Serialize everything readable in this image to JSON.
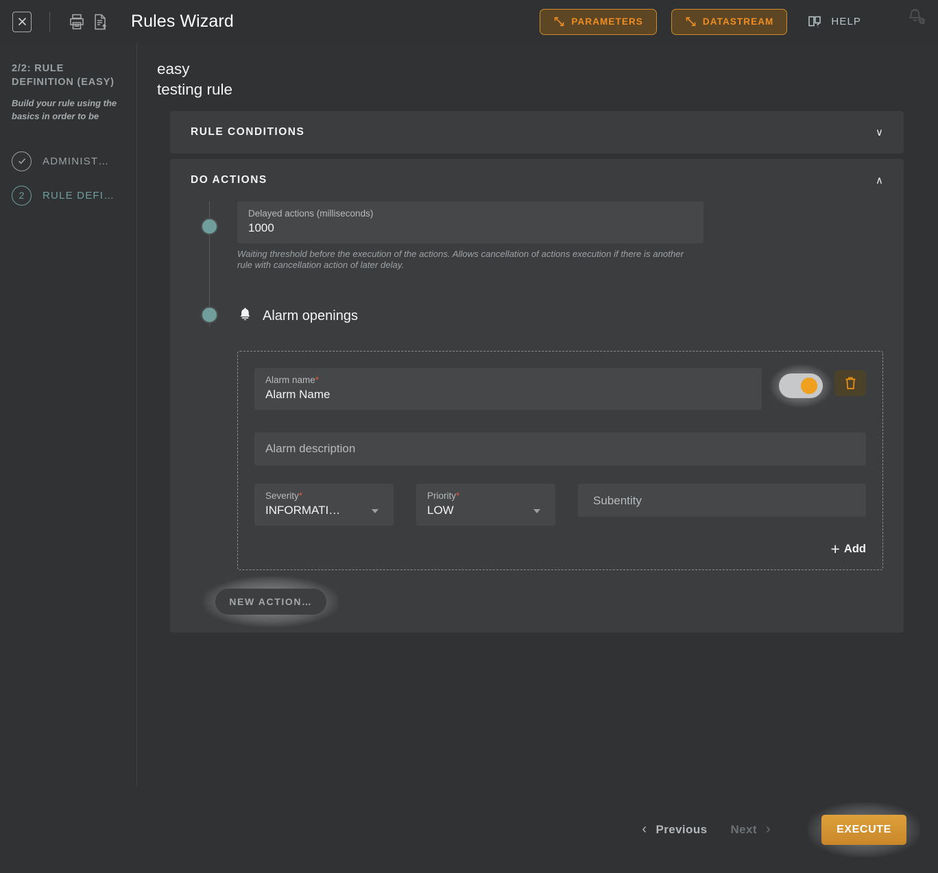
{
  "topbar": {
    "close_label": "☒",
    "close_icon": "close-boxed-icon",
    "print_icon": "print-icon",
    "export_icon": "document-upload-icon",
    "title": "Rules Wizard",
    "parameters_label": "PARAMETERS",
    "datastream_label": "DATASTREAM",
    "help_label": "HELP",
    "notification_settings_icon": "bell-gear-icon",
    "accent_orange": "#ef8e26"
  },
  "sidebar": {
    "step_heading": "2/2: RULE DEFINITION (EASY)",
    "step_description": "Build your rule using the basics in order to be",
    "steps": [
      {
        "icon": "check-circle-icon",
        "marker": "✓",
        "label": "ADMINIST…",
        "active": false
      },
      {
        "icon": "step-number-icon",
        "marker": "2",
        "label": "RULE DEFI…",
        "active": true
      }
    ],
    "active_color": "#6f9e9d"
  },
  "main": {
    "rule_title": "easy testing rule",
    "panels": [
      {
        "title": "RULE CONDITIONS",
        "expanded": false,
        "chevron": "∨"
      },
      {
        "title": "DO ACTIONS",
        "expanded": true,
        "chevron": "∧"
      }
    ],
    "delayed_actions": {
      "label": "Delayed actions (milliseconds)",
      "value": "1000",
      "helper": "Waiting threshold before the execution of the actions. Allows cancellation of actions execution if there is another rule with cancellation action of later delay."
    },
    "alarm_action": {
      "icon": "bell-icon",
      "heading": "Alarm openings",
      "alarm_name": {
        "label": "Alarm name",
        "required_mark": "*",
        "value": "Alarm Name"
      },
      "toggle": {
        "state": "on",
        "knob_color": "#efa020"
      },
      "delete_icon": "trash-icon",
      "description_placeholder": "Alarm description",
      "severity": {
        "label": "Severity",
        "required_mark": "*",
        "value": "INFORMATI…"
      },
      "priority": {
        "label": "Priority",
        "required_mark": "*",
        "value": "LOW"
      },
      "subentity_placeholder": "Subentity",
      "add_label": "Add",
      "add_plus": "+"
    },
    "new_action_label": "NEW ACTION…"
  },
  "footer": {
    "previous_label": "Previous",
    "previous_chevron": "‹",
    "next_label": "Next",
    "next_chevron": "›",
    "execute_label": "EXECUTE"
  }
}
